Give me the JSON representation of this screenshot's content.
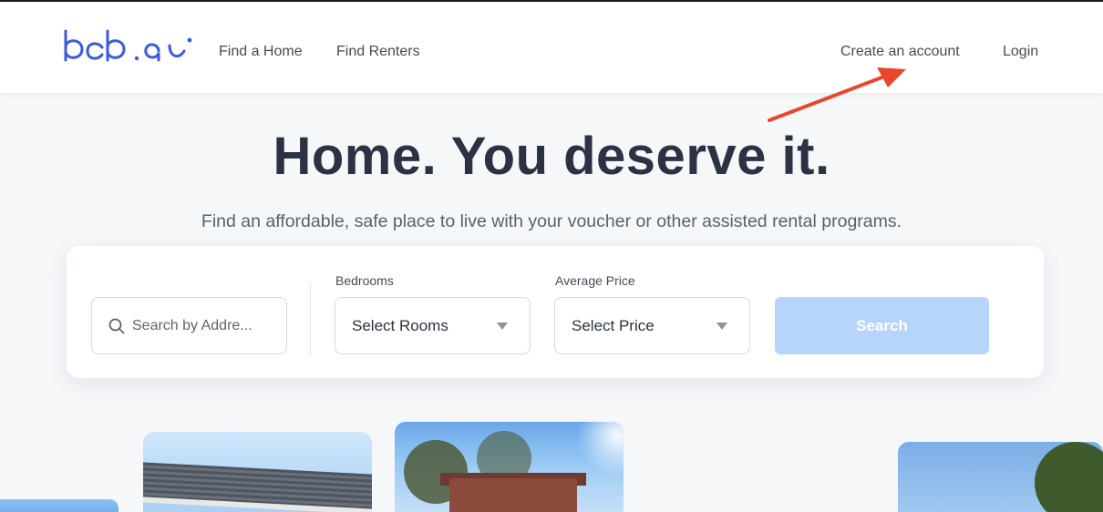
{
  "nav": {
    "links": {
      "find_home": "Find a Home",
      "find_renters": "Find Renters",
      "create_account": "Create an account",
      "login": "Login"
    }
  },
  "hero": {
    "title": "Home. You deserve it.",
    "subtitle": "Find an affordable, safe place to live with your voucher or other assisted rental programs."
  },
  "search": {
    "placeholder": "Search by Addre...",
    "bedrooms": {
      "label": "Bedrooms",
      "selected": "Select Rooms"
    },
    "price": {
      "label": "Average Price",
      "selected": "Select Price"
    },
    "button_label": "Search"
  },
  "colors": {
    "accent": "#3b5bdb",
    "search_button_disabled": "#b7d4fb",
    "annotation_arrow": "#e8472a",
    "heading": "#2b3244"
  },
  "icons": [
    "logo",
    "search-icon",
    "chevron-down-icon",
    "annotation-arrow"
  ]
}
